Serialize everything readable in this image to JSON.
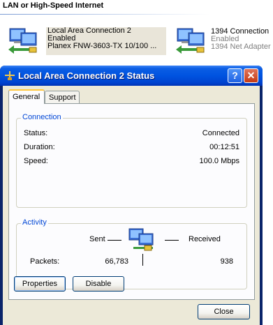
{
  "section": {
    "title": "LAN or High-Speed Internet"
  },
  "connections": [
    {
      "name": "Local Area Connection 2",
      "status": "Enabled",
      "device": "Planex FNW-3603-TX 10/100 ..."
    },
    {
      "name": "1394 Connection",
      "status": "Enabled",
      "device": "1394 Net Adapter"
    }
  ],
  "dialog": {
    "title": "Local Area Connection 2 Status",
    "help_label": "?",
    "close_glyph": "✕",
    "tabs": [
      "General",
      "Support"
    ],
    "connection_group": {
      "legend": "Connection",
      "rows": [
        {
          "label": "Status:",
          "value": "Connected"
        },
        {
          "label": "Duration:",
          "value": "00:12:51"
        },
        {
          "label": "Speed:",
          "value": "100.0 Mbps"
        }
      ]
    },
    "activity_group": {
      "legend": "Activity",
      "sent_label": "Sent",
      "received_label": "Received",
      "packets_label": "Packets:",
      "packets_sent": "66,783",
      "packets_received": "938"
    },
    "buttons": {
      "properties": "Properties",
      "disable": "Disable",
      "close": "Close"
    }
  },
  "colors": {
    "titlebar": "#0053e0",
    "group_legend": "#0046d5",
    "dialog_face": "#ece9d8"
  },
  "icons": [
    "network-connection-icon",
    "lan-status-icon",
    "help-icon",
    "close-icon"
  ]
}
